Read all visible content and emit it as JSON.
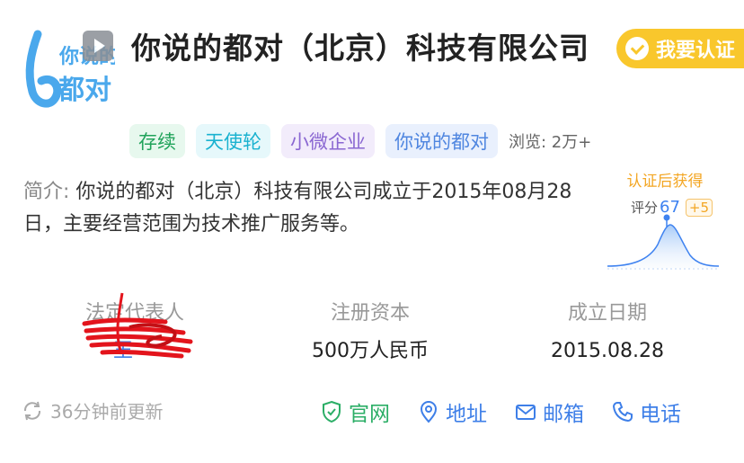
{
  "company": {
    "logo_text_top": "你说的",
    "logo_text_bottom": "都对",
    "name": "你说的都对（北京）科技有限公司",
    "cert_button": "我要认证"
  },
  "tags": [
    {
      "label": "存续",
      "color": "#21a35b"
    },
    {
      "label": "天使轮",
      "color": "#1ab2d0"
    },
    {
      "label": "小微企业",
      "color": "#8a67d2"
    },
    {
      "label": "你说的都对",
      "color": "#4f86e0"
    }
  ],
  "views": "浏览: 2万+",
  "intro": {
    "label": "简介:",
    "text": "你说的都对（北京）科技有限公司成立于2015年08月28日，主要经营范围为技术推广服务等。"
  },
  "score": {
    "heading": "认证后获得",
    "label": "评分",
    "value": "67",
    "bonus": "+5"
  },
  "info": {
    "legal_rep_label": "法定代表人",
    "legal_rep_value": "王",
    "capital_label": "注册资本",
    "capital_value": "500万人民币",
    "date_label": "成立日期",
    "date_value": "2015.08.28"
  },
  "footer": {
    "update_text": "36分钟前更新",
    "actions": [
      {
        "label": "官网",
        "icon": "shield-check-icon"
      },
      {
        "label": "地址",
        "icon": "location-pin-icon"
      },
      {
        "label": "邮箱",
        "icon": "mail-icon"
      },
      {
        "label": "电话",
        "icon": "phone-icon"
      }
    ]
  },
  "colors": {
    "accent_blue": "#3e7fe8",
    "cert_yellow": "#f9c72c",
    "gw_green": "#2bae66"
  }
}
